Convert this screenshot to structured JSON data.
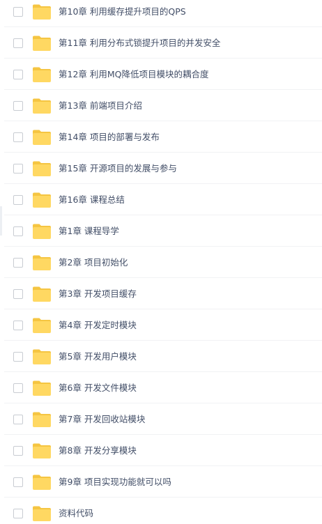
{
  "file_list": {
    "items": [
      {
        "name": "第10章 利用缓存提升项目的QPS"
      },
      {
        "name": "第11章 利用分布式锁提升项目的并发安全"
      },
      {
        "name": "第12章 利用MQ降低项目模块的耦合度"
      },
      {
        "name": "第13章 前端项目介绍"
      },
      {
        "name": "第14章 项目的部署与发布"
      },
      {
        "name": "第15章 开源项目的发展与参与"
      },
      {
        "name": "第16章 课程总结"
      },
      {
        "name": "第1章 课程导学"
      },
      {
        "name": "第2章 项目初始化"
      },
      {
        "name": "第3章 开发项目缓存"
      },
      {
        "name": "第4章 开发定时模块"
      },
      {
        "name": "第5章 开发用户模块"
      },
      {
        "name": "第6章 开发文件模块"
      },
      {
        "name": "第7章 开发回收站模块"
      },
      {
        "name": "第8章 开发分享模块"
      },
      {
        "name": "第9章 项目实现功能就可以吗"
      },
      {
        "name": "资料代码"
      }
    ]
  },
  "colors": {
    "folder_body": "#ffd862",
    "folder_back": "#f5c542",
    "label_text": "#424e67"
  },
  "icons": {
    "folder": "folder-icon",
    "checkbox": "checkbox"
  }
}
